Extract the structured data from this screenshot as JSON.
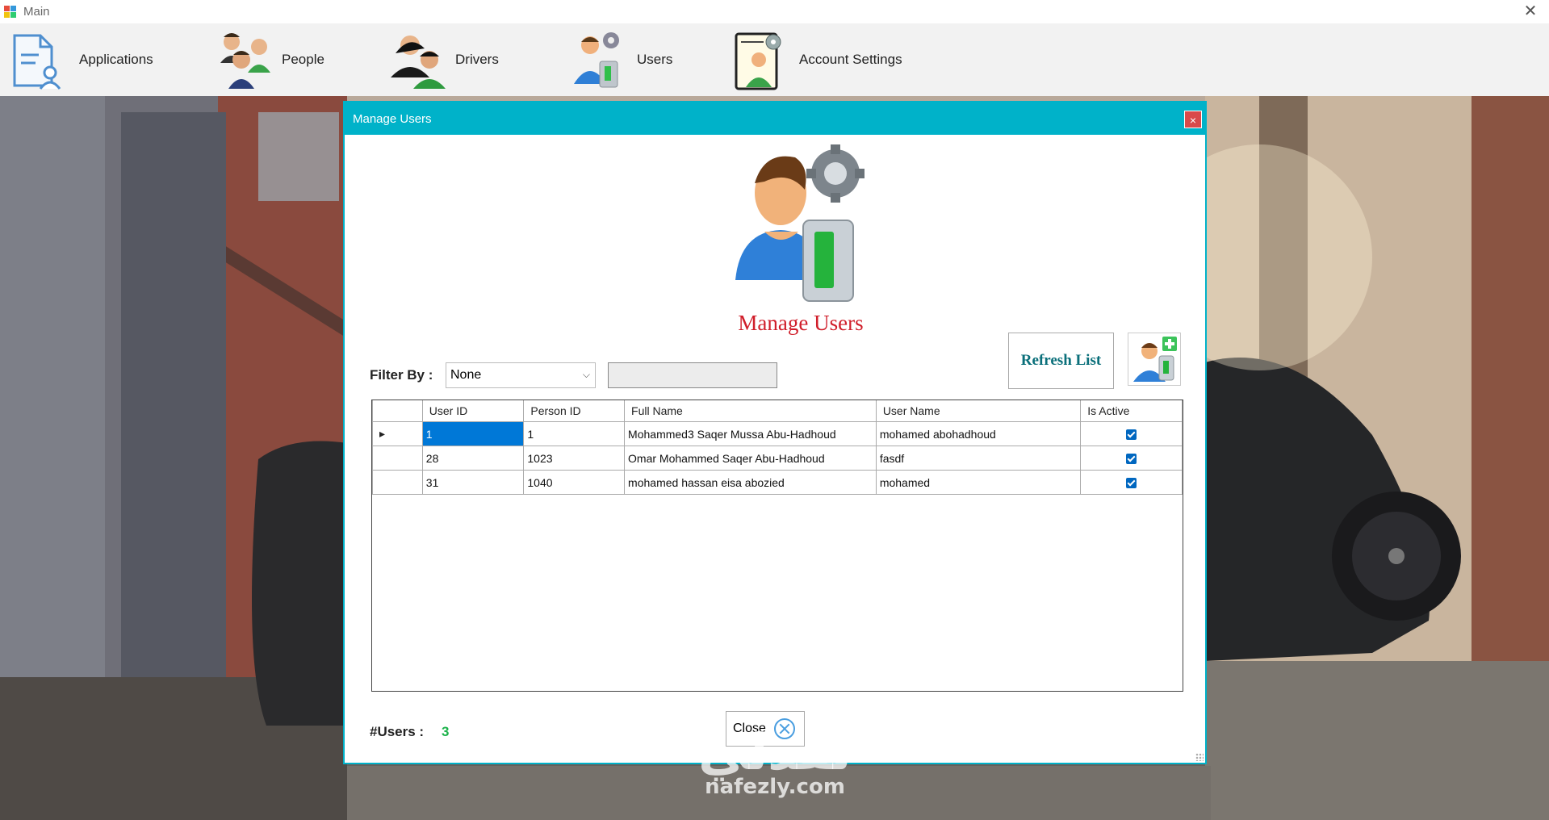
{
  "window": {
    "title": "Main",
    "close_glyph": "✕"
  },
  "menu": {
    "items": [
      {
        "label": "Applications",
        "icon": "document-user-icon"
      },
      {
        "label": "People",
        "icon": "people-group-icon"
      },
      {
        "label": "Drivers",
        "icon": "drivers-icon"
      },
      {
        "label": "Users",
        "icon": "user-settings-icon"
      },
      {
        "label": "Account Settings",
        "icon": "account-settings-icon"
      }
    ]
  },
  "dialog": {
    "title": "Manage Users",
    "close_glyph": "×",
    "heading": "Manage Users",
    "filter_label": "Filter By :",
    "filter_value": "None",
    "filter_text": "",
    "refresh_label": "Refresh List",
    "count_label": "#Users :",
    "count_value": "3",
    "close_label": "Close"
  },
  "grid": {
    "columns": [
      "User ID",
      "Person ID",
      "Full Name",
      "User Name",
      "Is Active"
    ],
    "rows": [
      {
        "user_id": "1",
        "person_id": "1",
        "full_name": "Mohammed3 Saqer Mussa Abu-Hadhoud",
        "user_name": "mohamed abohadhoud",
        "is_active": true
      },
      {
        "user_id": "28",
        "person_id": "1023",
        "full_name": "Omar Mohammed Saqer Abu-Hadhoud",
        "user_name": "fasdf",
        "is_active": true
      },
      {
        "user_id": "31",
        "person_id": "1040",
        "full_name": "mohamed hassan eisa abozied",
        "user_name": "mohamed",
        "is_active": true
      }
    ]
  },
  "watermark": {
    "arabic": "نفذلي",
    "latin": "nafezly.com"
  },
  "colors": {
    "accent": "#00b2c9",
    "title_red": "#d01e2a",
    "count_green": "#1bb24a",
    "selection": "#0078d7"
  }
}
